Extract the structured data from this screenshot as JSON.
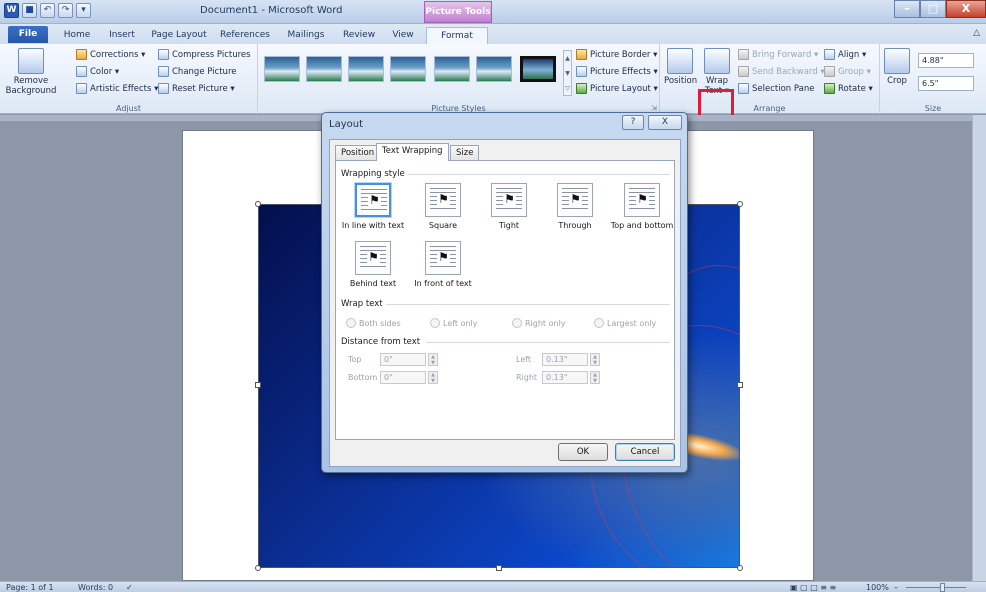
{
  "titlebar": {
    "document_title": "Document1 - Microsoft Word",
    "context_tab_title": "Picture Tools",
    "word_logo": "W",
    "qat_save": "■",
    "qat_undo": "↶",
    "qat_redo": "↷",
    "qat_customize": "▾",
    "minimize": "–",
    "maximize": "□",
    "close": "X"
  },
  "tabs": [
    {
      "label": "File"
    },
    {
      "label": "Home"
    },
    {
      "label": "Insert"
    },
    {
      "label": "Page Layout"
    },
    {
      "label": "References"
    },
    {
      "label": "Mailings"
    },
    {
      "label": "Review"
    },
    {
      "label": "View"
    },
    {
      "label": "Format"
    }
  ],
  "ribbon": {
    "adjust": {
      "label": "Adjust",
      "remove_background": "Remove Background",
      "corrections": "Corrections ▾",
      "color": "Color ▾",
      "artistic_effects": "Artistic Effects ▾",
      "compress_pictures": "Compress Pictures",
      "change_picture": "Change Picture",
      "reset_picture": "Reset Picture ▾"
    },
    "picture_styles": {
      "label": "Picture Styles",
      "picture_border": "Picture Border ▾",
      "picture_effects": "Picture Effects ▾",
      "picture_layout": "Picture Layout ▾"
    },
    "arrange": {
      "label": "Arrange",
      "position": "Position",
      "wrap_text": "Wrap Text ▾",
      "bring_forward": "Bring Forward ▾",
      "send_backward": "Send Backward ▾",
      "selection_pane": "Selection Pane",
      "align": "Align ▾",
      "group": "Group ▾",
      "rotate": "Rotate ▾"
    },
    "size": {
      "label": "Size",
      "crop": "Crop",
      "height": "4.88\"",
      "width": "6.5\""
    }
  },
  "dialog": {
    "title": "Layout",
    "help": "?",
    "close": "X",
    "tabs": [
      {
        "label": "Position"
      },
      {
        "label": "Text Wrapping"
      },
      {
        "label": "Size"
      }
    ],
    "wrapping_style_label": "Wrapping style",
    "wrapping_styles": [
      {
        "label": "In line with text"
      },
      {
        "label": "Square"
      },
      {
        "label": "Tight"
      },
      {
        "label": "Through"
      },
      {
        "label": "Top and bottom"
      },
      {
        "label": "Behind text"
      },
      {
        "label": "In front of text"
      }
    ],
    "wrap_text_label": "Wrap text",
    "wrap_text_options": [
      {
        "label": "Both sides"
      },
      {
        "label": "Left only"
      },
      {
        "label": "Right only"
      },
      {
        "label": "Largest only"
      }
    ],
    "distance_label": "Distance from text",
    "distance": {
      "top_label": "Top",
      "top_value": "0\"",
      "bottom_label": "Bottom",
      "bottom_value": "0\"",
      "left_label": "Left",
      "left_value": "0.13\"",
      "right_label": "Right",
      "right_value": "0.13\""
    },
    "ok": "OK",
    "cancel": "Cancel"
  },
  "statusbar": {
    "page": "Page: 1 of 1",
    "words": "Words: 0",
    "zoom": "100%",
    "zoom_out": "–"
  },
  "colors": {
    "accent_highlight": "#e31b3a",
    "file_tab": "#2b5ab3",
    "context_tab": "#c27fd0"
  }
}
